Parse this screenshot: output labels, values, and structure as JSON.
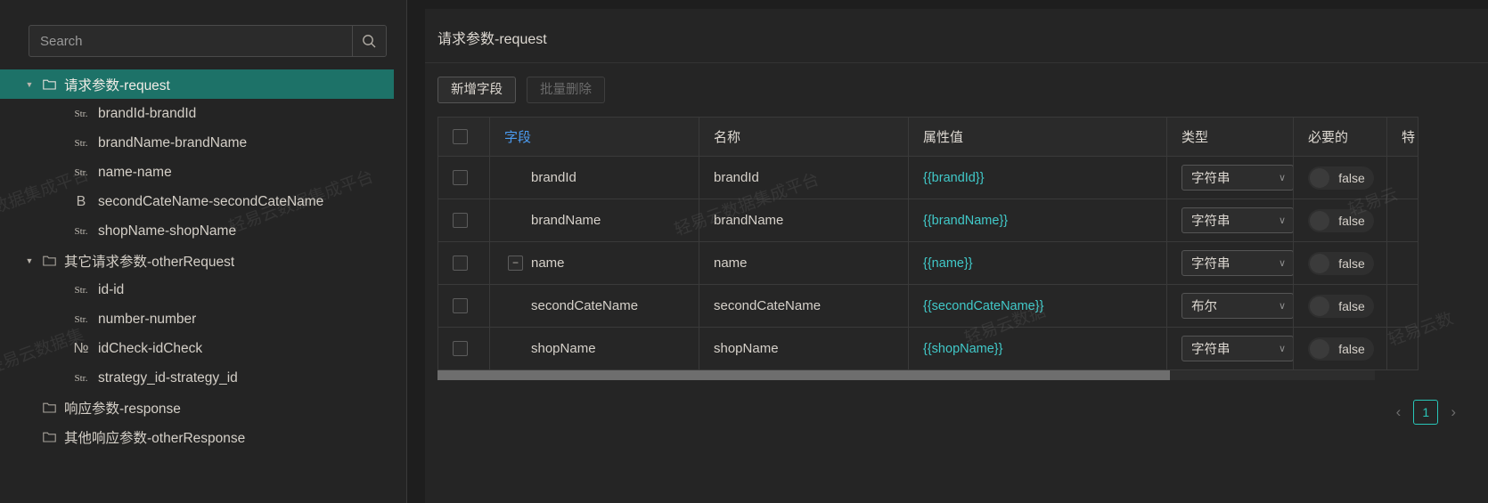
{
  "sidebar": {
    "search": {
      "placeholder": "Search",
      "value": "",
      "icon": "search-icon"
    },
    "tree": [
      {
        "label": "请求参数-request",
        "kind": "folder",
        "depth": 0,
        "expanded": true,
        "selected": true,
        "icon": "folder-icon"
      },
      {
        "label": "brandId-brandId",
        "kind": "leaf",
        "depth": 1,
        "type_badge": "Str.",
        "icon": "string-type-icon"
      },
      {
        "label": "brandName-brandName",
        "kind": "leaf",
        "depth": 1,
        "type_badge": "Str.",
        "icon": "string-type-icon"
      },
      {
        "label": "name-name",
        "kind": "leaf",
        "depth": 1,
        "type_badge": "Str.",
        "icon": "string-type-icon"
      },
      {
        "label": "secondCateName-secondCateName",
        "kind": "leaf",
        "depth": 1,
        "type_badge": "B",
        "icon": "boolean-type-icon"
      },
      {
        "label": "shopName-shopName",
        "kind": "leaf",
        "depth": 1,
        "type_badge": "Str.",
        "icon": "string-type-icon"
      },
      {
        "label": "其它请求参数-otherRequest",
        "kind": "folder",
        "depth": 0,
        "expanded": true,
        "selected": false,
        "icon": "folder-icon"
      },
      {
        "label": "id-id",
        "kind": "leaf",
        "depth": 1,
        "type_badge": "Str.",
        "icon": "string-type-icon"
      },
      {
        "label": "number-number",
        "kind": "leaf",
        "depth": 1,
        "type_badge": "Str.",
        "icon": "string-type-icon"
      },
      {
        "label": "idCheck-idCheck",
        "kind": "leaf",
        "depth": 1,
        "type_badge": "№",
        "icon": "number-type-icon"
      },
      {
        "label": "strategy_id-strategy_id",
        "kind": "leaf",
        "depth": 1,
        "type_badge": "Str.",
        "icon": "string-type-icon"
      },
      {
        "label": "响应参数-response",
        "kind": "folder",
        "depth": 0,
        "expanded": false,
        "selected": false,
        "icon": "folder-icon"
      },
      {
        "label": "其他响应参数-otherResponse",
        "kind": "folder",
        "depth": 0,
        "expanded": false,
        "selected": false,
        "icon": "folder-icon"
      }
    ]
  },
  "panel": {
    "title": "请求参数-request",
    "toolbar": {
      "add_field_label": "新增字段",
      "batch_delete_label": "批量删除"
    },
    "table": {
      "columns": [
        "字段",
        "名称",
        "属性值",
        "类型",
        "必要的",
        "特"
      ],
      "rows": [
        {
          "field": "brandId",
          "name": "brandId",
          "value": "{{brandId}}",
          "type": "字符串",
          "required": "false",
          "expander": ""
        },
        {
          "field": "brandName",
          "name": "brandName",
          "value": "{{brandName}}",
          "type": "字符串",
          "required": "false",
          "expander": ""
        },
        {
          "field": "name",
          "name": "name",
          "value": "{{name}}",
          "type": "字符串",
          "required": "false",
          "expander": "−"
        },
        {
          "field": "secondCateName",
          "name": "secondCateName",
          "value": "{{secondCateName}}",
          "type": "布尔",
          "required": "false",
          "expander": ""
        },
        {
          "field": "shopName",
          "name": "shopName",
          "value": "{{shopName}}",
          "type": "字符串",
          "required": "false",
          "expander": ""
        }
      ]
    },
    "pagination": {
      "prev": "‹",
      "next": "›",
      "current_page": "1"
    }
  },
  "watermarks": [
    "数据集成平台",
    "轻易云数据集成平台",
    "轻易云",
    "轻易云数据集成平台",
    "轻易云数据集",
    "成平台",
    "轻易云数据",
    "轻易云数"
  ],
  "colors": {
    "accent_teal": "#1d7268",
    "link_blue": "#4b9bf0",
    "value_cyan": "#41c9c9",
    "pager_teal": "#29c6b8",
    "bg": "#1e1e1e",
    "panel_bg": "#252525"
  }
}
